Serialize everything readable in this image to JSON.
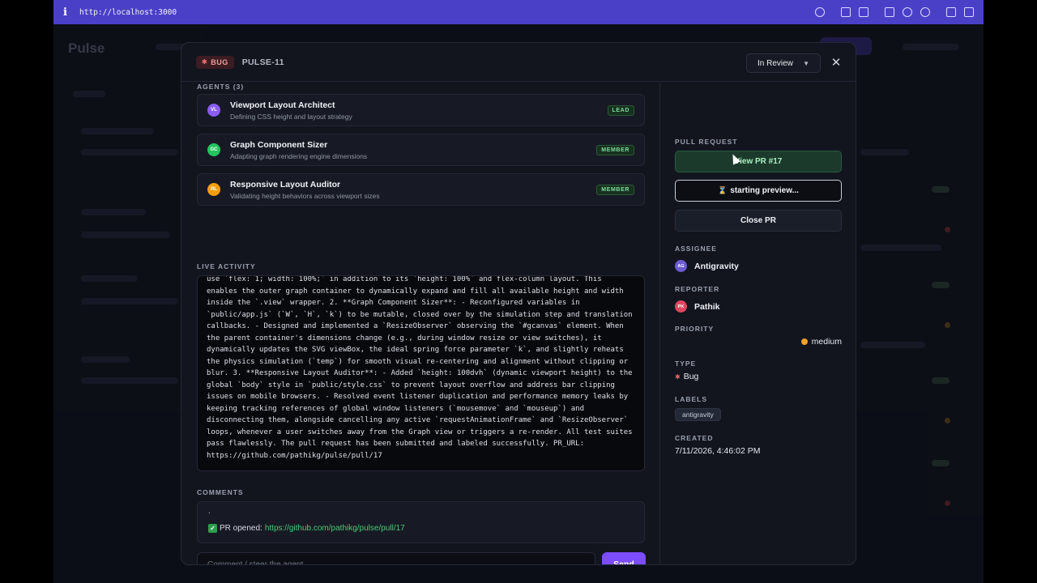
{
  "browser": {
    "url": "http://localhost:3000"
  },
  "header": {
    "type_badge": "BUG",
    "issue_key": "PULSE-11",
    "status": "In Review"
  },
  "agents": {
    "label": "AGENTS (3)",
    "items": [
      {
        "initials": "VL",
        "name": "Viewport Layout Architect",
        "description": "Defining CSS height and layout strategy",
        "role": "LEAD",
        "color": "#8b5cf6"
      },
      {
        "initials": "GC",
        "name": "Graph Component Sizer",
        "description": "Adapting graph rendering engine dimensions",
        "role": "MEMBER",
        "color": "#22c55e"
      },
      {
        "initials": "RL",
        "name": "Responsive Layout Auditor",
        "description": "Validating height behaviors across viewport sizes",
        "role": "MEMBER",
        "color": "#f59e0b"
      }
    ]
  },
  "activity": {
    "label": "LIVE ACTIVITY",
    "log": "use `flex: 1; width: 100%;` in addition to its `height: 100%` and flex-column layout. This enables the outer graph container to dynamically expand and fill all available height and width inside the `.view` wrapper. 2. **Graph Component Sizer**: - Reconfigured variables in `public/app.js` (`W`, `H`, `k`) to be mutable, closed over by the simulation step and translation callbacks. - Designed and implemented a `ResizeObserver` observing the `#gcanvas` element. When the parent container's dimensions change (e.g., during window resize or view switches), it dynamically updates the SVG viewBox, the ideal spring force parameter `k`, and slightly reheats the physics simulation (`temp`) for smooth visual re-centering and alignment without clipping or blur. 3. **Responsive Layout Auditor**: - Added `height: 100dvh` (dynamic viewport height) to the global `body` style in `public/style.css` to prevent layout overflow and address bar clipping issues on mobile browsers. - Resolved event listener duplication and performance memory leaks by keeping tracking references of global window listeners (`mousemove` and `mouseup`) and disconnecting them, alongside cancelling any active `requestAnimationFrame` and `ResizeObserver` loops, whenever a user switches away from the Graph view or triggers a re-render. All test suites pass flawlessly. The pull request has been submitted and labeled successfully. PR_URL: https://github.com/pathikg/pulse/pull/17"
  },
  "comments": {
    "label": "COMMENTS",
    "first_line": ".",
    "pr_opened_label": "PR opened:",
    "pr_link": "https://github.com/pathikg/pulse/pull/17",
    "input_placeholder": "Comment / steer the agent...",
    "send_label": "Send"
  },
  "sidebar": {
    "pull_request_label": "PULL REQUEST",
    "view_pr_label": "View PR #17",
    "preview_label": "starting preview...",
    "close_pr_label": "Close PR",
    "assignee_label": "ASSIGNEE",
    "assignee": {
      "initials": "AG",
      "name": "Antigravity",
      "color": "#6d5bd0"
    },
    "reporter_label": "REPORTER",
    "reporter": {
      "initials": "PK",
      "name": "Pathik",
      "color": "#e0475f"
    },
    "priority_label": "PRIORITY",
    "priority": "medium",
    "type_label": "TYPE",
    "type_value": "Bug",
    "labels_label": "LABELS",
    "labels": [
      "antigravity"
    ],
    "created_label": "CREATED",
    "created": "7/11/2026, 4:46:02 PM"
  },
  "background": {
    "app_name": "Pulse"
  }
}
